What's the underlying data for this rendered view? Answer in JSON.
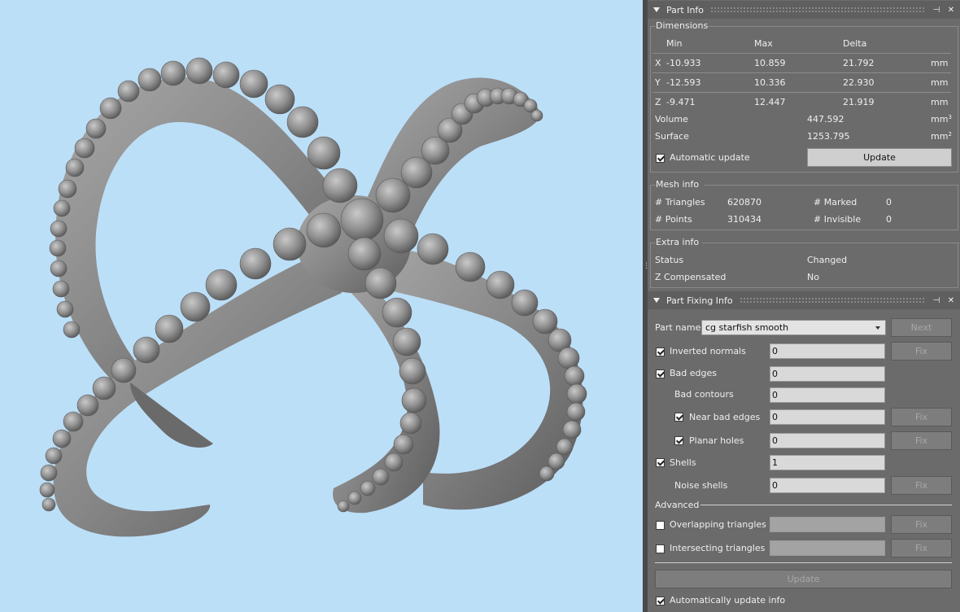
{
  "part_info": {
    "title": "Part Info",
    "dimensions": {
      "group_title": "Dimensions",
      "headers": {
        "min": "Min",
        "max": "Max",
        "delta": "Delta"
      },
      "rows": [
        {
          "axis": "X",
          "min": "-10.933",
          "max": "10.859",
          "delta": "21.792",
          "unit": "mm"
        },
        {
          "axis": "Y",
          "min": "-12.593",
          "max": "10.336",
          "delta": "22.930",
          "unit": "mm"
        },
        {
          "axis": "Z",
          "min": "-9.471",
          "max": "12.447",
          "delta": "21.919",
          "unit": "mm"
        }
      ],
      "volume_label": "Volume",
      "volume_value": "447.592",
      "volume_unit": "mm",
      "volume_sup": "3",
      "surface_label": "Surface",
      "surface_value": "1253.795",
      "surface_unit": "mm",
      "surface_sup": "2",
      "auto_update_label": "Automatic update",
      "auto_update_checked": true,
      "update_button": "Update"
    },
    "mesh_info": {
      "group_title": "Mesh info",
      "triangles_label": "# Triangles",
      "triangles_value": "620870",
      "points_label": "# Points",
      "points_value": "310434",
      "marked_label": "# Marked",
      "marked_value": "0",
      "invisible_label": "# Invisible",
      "invisible_value": "0"
    },
    "extra_info": {
      "group_title": "Extra info",
      "status_label": "Status",
      "status_value": "Changed",
      "zcomp_label": "Z Compensated",
      "zcomp_value": "No"
    }
  },
  "part_fixing": {
    "title": "Part Fixing Info",
    "part_name_label": "Part name",
    "part_name_value": "cg starfish smooth",
    "next_button": "Next",
    "fix_label": "Fix",
    "rows": [
      {
        "label": "Inverted normals",
        "value": "0",
        "checked": true
      },
      {
        "label": "Bad edges",
        "value": "0",
        "checked": true
      },
      {
        "label": "Bad contours",
        "value": "0"
      },
      {
        "label": "Near bad edges",
        "value": "0",
        "checked": true
      },
      {
        "label": "Planar holes",
        "value": "0",
        "checked": true
      },
      {
        "label": "Shells",
        "value": "1",
        "checked": true
      },
      {
        "label": "Noise shells",
        "value": "0"
      }
    ],
    "advanced_label": "Advanced",
    "overlapping_label": "Overlapping triangles",
    "intersecting_label": "Intersecting triangles",
    "update_button": "Update",
    "auto_update_info_label": "Automatically update info",
    "auto_update_info_checked": true
  },
  "colors": {
    "viewport_bg": "#bcdff8",
    "panel_bg": "#6b6b6b",
    "model_gray": "#8a8a8a"
  }
}
